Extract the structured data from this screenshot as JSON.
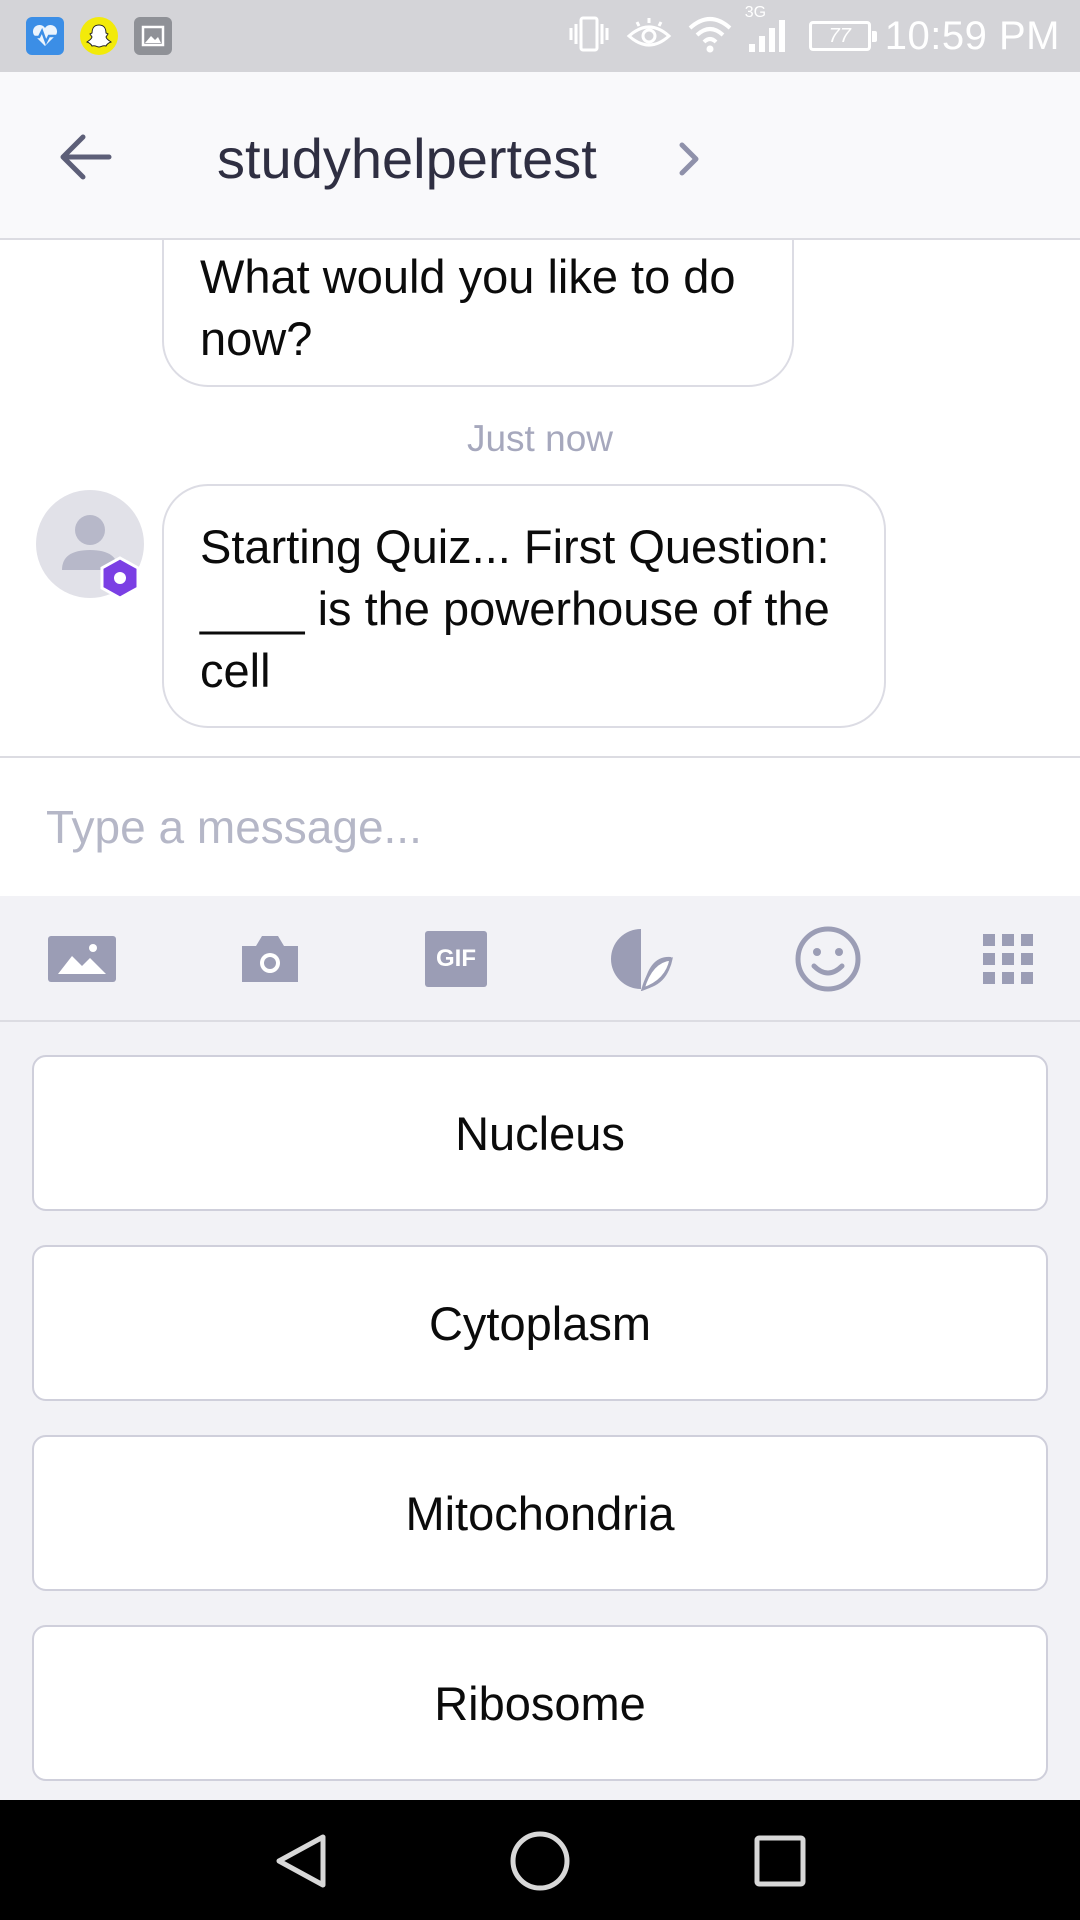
{
  "status_bar": {
    "time": "10:59 PM",
    "battery": "77",
    "network": "3G",
    "apps": [
      "health-app-icon",
      "snapchat-icon",
      "gallery-icon"
    ]
  },
  "header": {
    "title": "studyhelpertest"
  },
  "messages": {
    "previous": "What would you like to do now?",
    "timestamp": "Just now",
    "bot_message": "Starting Quiz... First Question: ____ is the powerhouse of the cell"
  },
  "composer": {
    "placeholder": "Type a message..."
  },
  "toolbar": {
    "gif_label": "GIF",
    "icons": [
      "image-icon",
      "camera-icon",
      "gif-icon",
      "sticker-icon",
      "emoji-icon",
      "apps-grid-icon"
    ]
  },
  "answers": [
    "Nucleus",
    "Cytoplasm",
    "Mitochondria",
    "Ribosome"
  ],
  "colors": {
    "accent": "#7b3fe4",
    "icon": "#9b9db5",
    "title": "#2f2f42",
    "timestamp": "#a6a8bd"
  }
}
